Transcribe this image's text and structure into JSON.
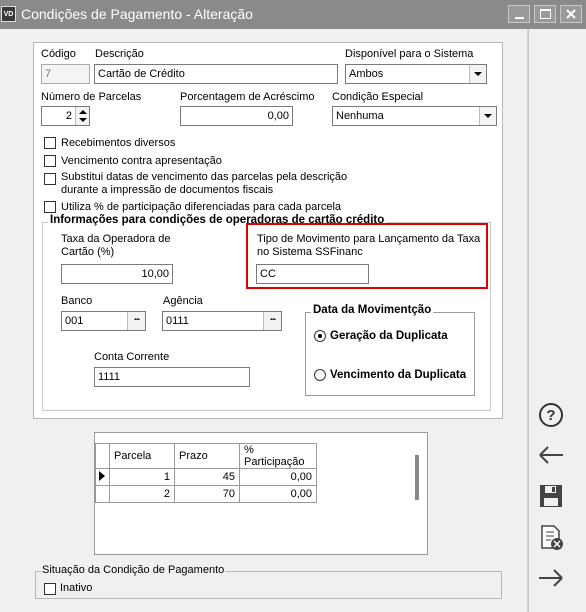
{
  "window": {
    "app_icon_text": "VD",
    "title": "Condições de Pagamento - Alteração"
  },
  "form": {
    "codigo_label": "Código",
    "codigo_value": "7",
    "descricao_label": "Descrição",
    "descricao_value": "Cartão de Crédito",
    "disponivel_label": "Disponível para o Sistema",
    "disponivel_value": "Ambos",
    "parcelas_label": "Número de Parcelas",
    "parcelas_value": "2",
    "acrescimo_label": "Porcentagem de Acréscimo",
    "acrescimo_value": "0,00",
    "condicao_label": "Condição Especial",
    "condicao_value": "Nenhuma",
    "checkboxes": [
      {
        "label": "Recebimentos diversos"
      },
      {
        "label": "Vencimento contra apresentação"
      },
      {
        "label": "Substitui datas de vencimento das parcelas pela descrição"
      },
      {
        "label": "Utiliza % de participação diferenciadas para cada parcela"
      }
    ],
    "checkbox_line2": "durante a impressão de documentos fiscais"
  },
  "card_group": {
    "title": "Informações para condições de operadoras de cartão crédito",
    "taxa_label_1": "Taxa da Operadora de",
    "taxa_label_2": "Cartão (%)",
    "taxa_value": "10,00",
    "tipo_label_1": "Tipo de Movimento para Lançamento da Taxa",
    "tipo_label_2": "no Sistema SSFinanc",
    "tipo_value": "CC",
    "banco_label": "Banco",
    "banco_value": "001",
    "agencia_label": "Agência",
    "agencia_value": "0111",
    "conta_label": "Conta Corrente",
    "conta_value": "1111",
    "lookup_glyph": "..."
  },
  "movimentacao": {
    "title": "Data da Movimentção",
    "options": [
      {
        "label": "Geração da Duplicata",
        "selected": true
      },
      {
        "label": "Vencimento da Duplicata",
        "selected": false
      }
    ]
  },
  "parcelas_table": {
    "headers": [
      "Parcela",
      "Prazo",
      "% Participação"
    ],
    "rows": [
      {
        "parcela": "1",
        "prazo": "45",
        "participacao": "0,00"
      },
      {
        "parcela": "2",
        "prazo": "70",
        "participacao": "0,00"
      }
    ]
  },
  "situacao": {
    "title": "Situação da Condição de Pagamento",
    "inativo_label": "Inativo"
  },
  "sidebar_icons": [
    "help-icon",
    "back-arrow-icon",
    "save-icon",
    "delete-document-icon",
    "forward-arrow-icon"
  ]
}
